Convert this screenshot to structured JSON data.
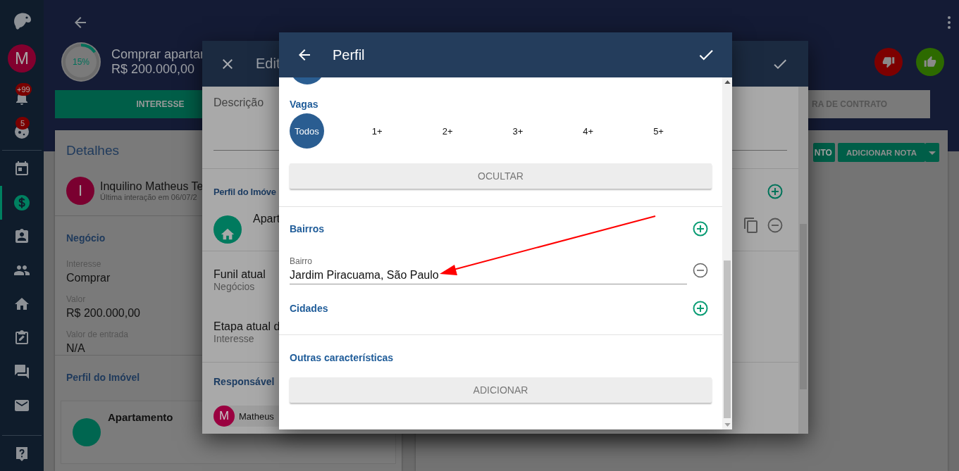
{
  "sidebar": {
    "avatar": "M",
    "items": [
      {
        "badge": "+99",
        "selected": false
      },
      {
        "badge": "5",
        "selected": false
      },
      {
        "selected": false
      },
      {
        "selected": true
      },
      {
        "selected": false
      },
      {
        "selected": false
      },
      {
        "selected": false
      },
      {
        "selected": false
      },
      {
        "selected": false
      },
      {
        "selected": false
      }
    ]
  },
  "deal": {
    "progress": {
      "level": 0.15,
      "label": "15%"
    },
    "title": "Comprar apartar",
    "value": "R$ 200.000,00"
  },
  "stage_tabs": [
    {
      "label": "INTERESSE",
      "selected": true
    },
    {
      "label": "RA DE CONTRATO",
      "selected": false
    }
  ],
  "details": {
    "title": "Detalhes",
    "contact": {
      "initial": "I",
      "name": "Inquilino Matheus Te",
      "last_interaction": "Última interação em 06/07/2"
    },
    "section": "Negócio",
    "fields": [
      {
        "label": "Interesse",
        "value": "Comprar"
      },
      {
        "label": "Valor",
        "value": "R$ 200.000,00"
      },
      {
        "label": "Valor de entrada",
        "value": "N/A"
      }
    ],
    "profile_title": "Perfil do Imóvel",
    "property": "Apartamento"
  },
  "actions": {
    "buttons": [
      "NTO",
      "ADICIONAR NOTA"
    ]
  },
  "edit_dialog": {
    "title": "Edit",
    "description_label": "Descrição",
    "profile_title": "Perfil do Imóve",
    "property": "Apart",
    "fields": [
      {
        "label": "Funil atual",
        "value": "Negócios"
      },
      {
        "label": "Etapa atual d",
        "value": "Interesse"
      }
    ],
    "owner_title": "Responsável",
    "owner": {
      "initial": "M",
      "name": "Matheus"
    }
  },
  "profile_dialog": {
    "title": "Perfil",
    "vagas": {
      "title": "Vagas",
      "options": [
        {
          "label": "Todos",
          "selected": true
        },
        {
          "label": "1+",
          "selected": false
        },
        {
          "label": "2+",
          "selected": false
        },
        {
          "label": "3+",
          "selected": false
        },
        {
          "label": "4+",
          "selected": false
        },
        {
          "label": "5+",
          "selected": false
        }
      ]
    },
    "hide_button": "OCULTAR",
    "bairros": {
      "title": "Bairros",
      "items": [
        {
          "label": "Bairro",
          "value": "Jardim Piracuama, São Paulo"
        }
      ]
    },
    "cidades_title": "Cidades",
    "other_title": "Outras características",
    "add_button": "ADICIONAR"
  }
}
